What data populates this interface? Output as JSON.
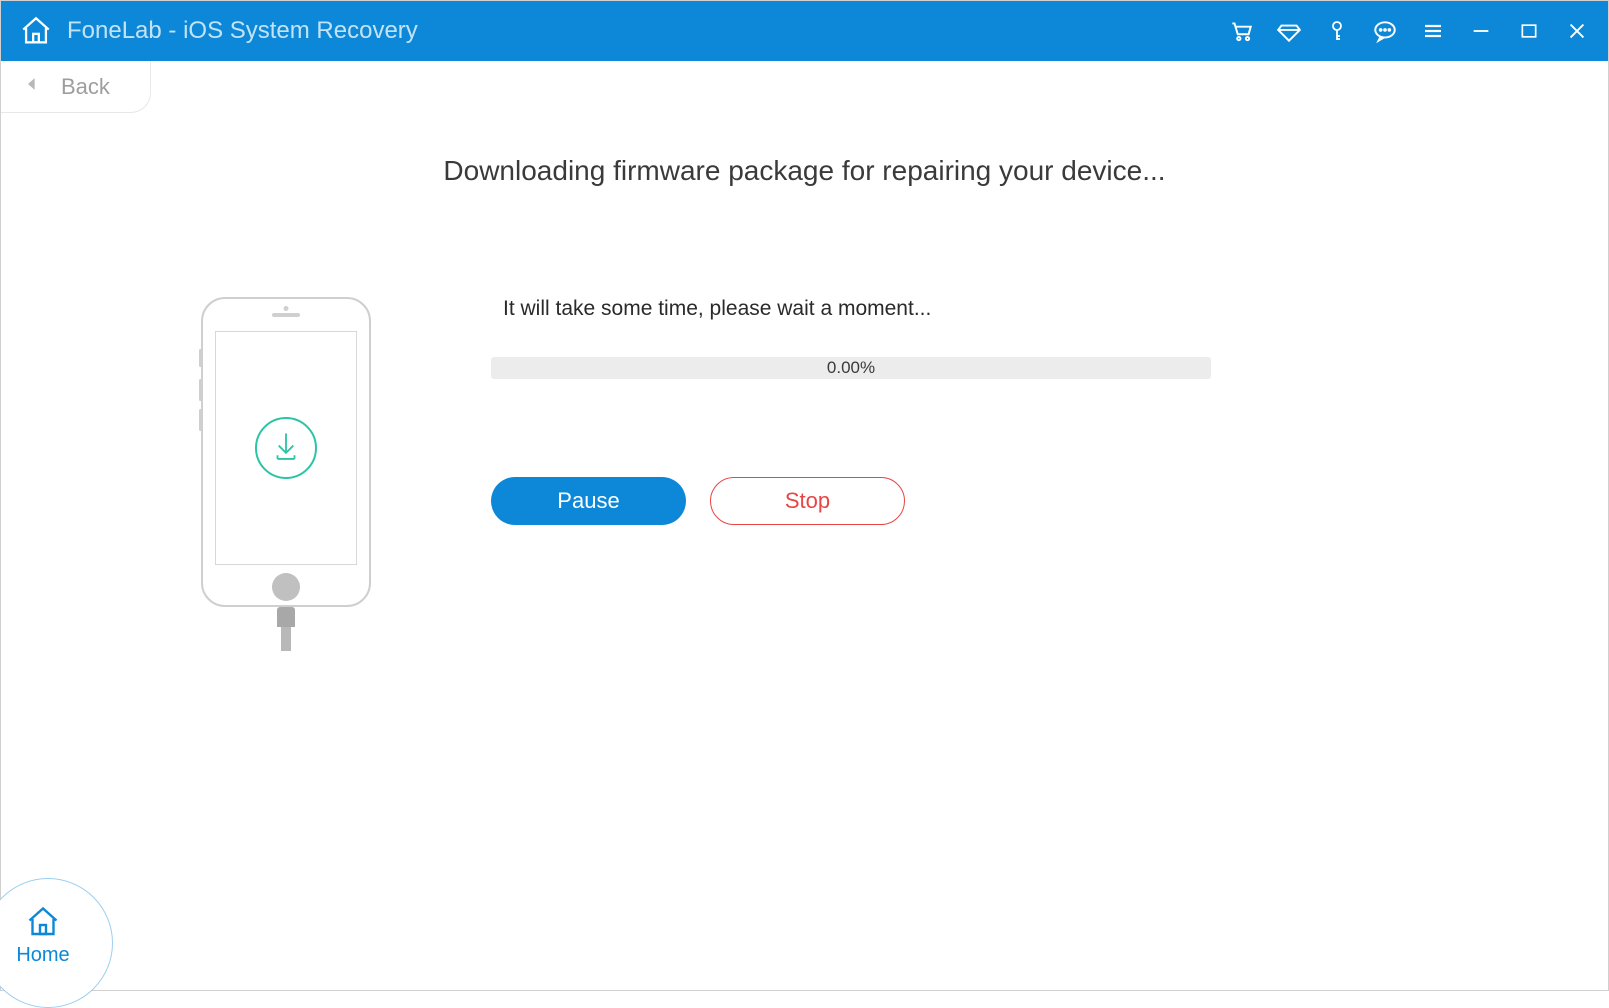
{
  "titlebar": {
    "app_title": "FoneLab - iOS System Recovery"
  },
  "back": {
    "label": "Back"
  },
  "main": {
    "heading": "Downloading firmware package for repairing your device...",
    "wait_text": "It will take some time, please wait a moment...",
    "progress_percent": "0.00%",
    "pause_label": "Pause",
    "stop_label": "Stop"
  },
  "home_corner": {
    "label": "Home"
  },
  "icons": {
    "home": "home-icon",
    "cart": "cart-icon",
    "diamond": "diamond-icon",
    "key": "key-icon",
    "chat": "chat-icon",
    "menu": "menu-icon",
    "minimize": "minimize-icon",
    "maximize": "maximize-icon",
    "close": "close-icon"
  },
  "colors": {
    "primary": "#0d88d8",
    "danger": "#e84545",
    "accent_green": "#2bc4a5"
  }
}
